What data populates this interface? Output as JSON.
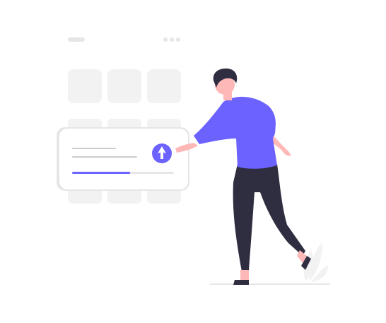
{
  "illustration": {
    "subject": "upload-illustration",
    "colors": {
      "accent": "#6c63ff",
      "tile": "#f2f2f2",
      "card_shadow": "#e6e6e6",
      "card": "#ffffff",
      "skin": "#ffb8b8",
      "hair": "#2f2e41",
      "pants": "#2f2e41",
      "line": "#e6e6e6",
      "placeholder_line": "#cccccc"
    },
    "progress": {
      "value": 0.57
    },
    "icons": {
      "upload": "arrow-up-icon",
      "menu": "three-dots-icon"
    }
  }
}
